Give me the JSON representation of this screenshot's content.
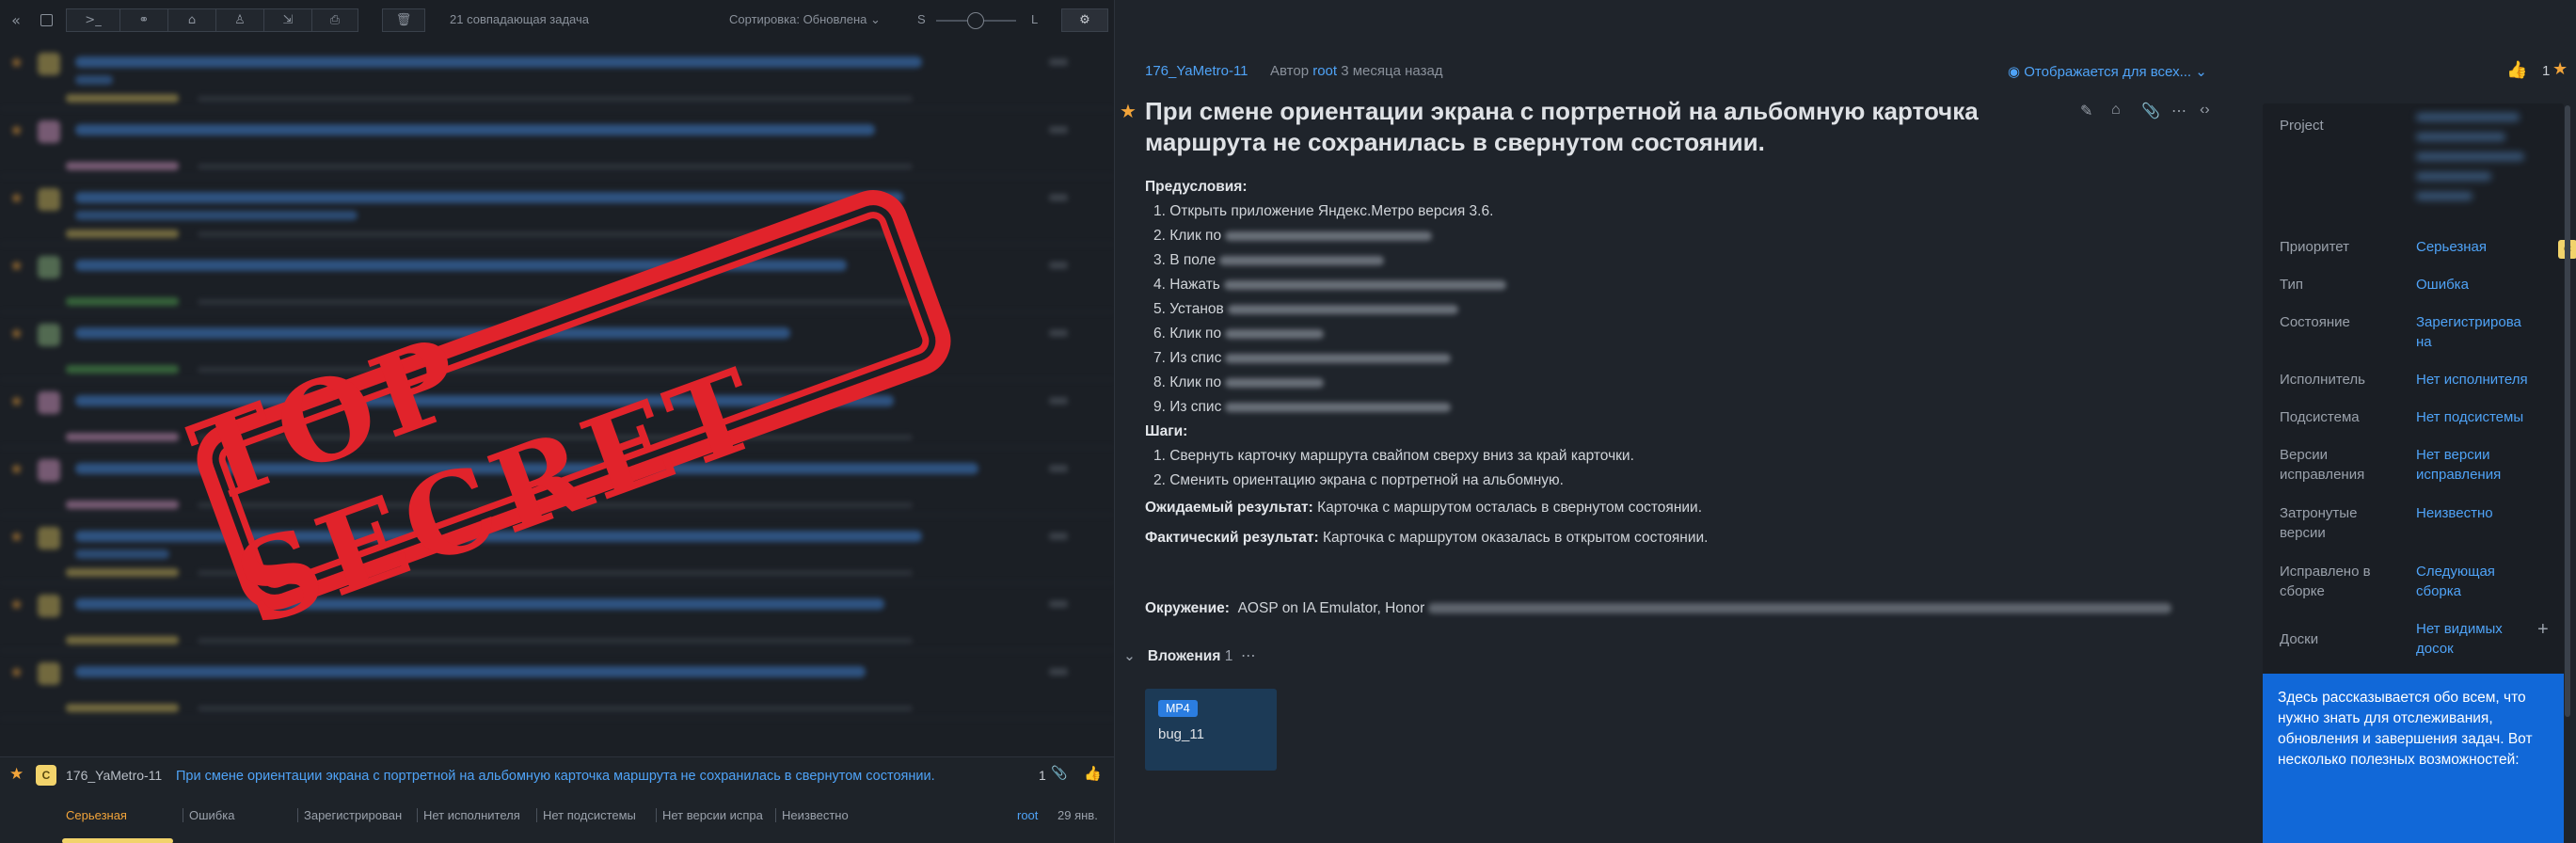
{
  "toolbar": {
    "collapse_icon": "double-chevron-left-icon",
    "match_count": "21 совпадающая задача",
    "sort_label": "Сортировка: Обновлена",
    "size_small": "S",
    "size_large": "L"
  },
  "selected_issue": {
    "avatar_letter": "C",
    "key": "176_YaMetro-11",
    "title": "При смене ориентации экрана с портретной на альбомную карточка маршрута не сохранилась в свернутом состоянии.",
    "attachment_count": "1",
    "priority": "Серьезная",
    "type": "Ошибка",
    "state": "Зарегистрирован",
    "assignee": "Нет исполнителя",
    "subsystem": "Нет подсистемы",
    "fix_versions": "Нет версии испра",
    "affected": "Неизвестно",
    "author": "root",
    "date": "29 янв."
  },
  "stamp": {
    "text": "TOP SECRET",
    "color": "#e1232b"
  },
  "issue": {
    "key": "176_YaMetro-11",
    "author_prefix": "Автор",
    "author": "root",
    "age": "3 месяца назад",
    "visibility": "Отображается для всех...",
    "like_count": "1",
    "title": "При смене ориентации экрана с портретной на альбомную карточка маршрута не сохранилась в свернутом состоянии.",
    "preconditions_heading": "Предусловия:",
    "preconditions": [
      "1. Открыть приложение Яндекс.Метро версия 3.6.",
      "2. Клик по",
      "3. В поле",
      "4. Нажать",
      "5. Установ",
      "6. Клик по",
      "7. Из спис",
      "8. Клик по",
      "9. Из спис"
    ],
    "steps_heading": "Шаги:",
    "steps": [
      "1. Свернуть карточку маршрута свайпом сверху вниз за край карточки.",
      "2. Сменить ориентацию экрана с портретной на альбомную."
    ],
    "expected_label": "Ожидаемый результат:",
    "expected": "Карточка с маршрутом осталась в свернутом состоянии.",
    "actual_label": "Фактический результат:",
    "actual": "Карточка с маршрутом оказалась в открытом состоянии.",
    "env_label": "Окружение:",
    "env": "AOSP on IA Emulator, Honor",
    "attachments_label": "Вложения",
    "attachments_count": "1",
    "attachment_type": "MP4",
    "attachment_name": "bug_11"
  },
  "side_panel": {
    "project_label": "Project",
    "fields": [
      {
        "label": "Приоритет",
        "value": "Серьезная"
      },
      {
        "label": "Тип",
        "value": "Ошибка"
      },
      {
        "label": "Состояние",
        "value": "Зарегистрирова на"
      },
      {
        "label": "Исполнитель",
        "value": "Нет исполнителя"
      },
      {
        "label": "Подсистема",
        "value": "Нет подсистемы"
      },
      {
        "label": "Версии исправления",
        "value": "Нет версии исправления"
      },
      {
        "label": "Затронутые версии",
        "value": "Неизвестно"
      },
      {
        "label": "Исправлено в сборке",
        "value": "Следующая сборка"
      },
      {
        "label": "Доски",
        "value": "Нет видимых досок"
      }
    ],
    "priority_badge": "C",
    "help_text": "Здесь рассказывается обо всем, что нужно знать для отслеживания, обновления и завершения задач. Вот несколько полезных возможностей:"
  },
  "colors": {
    "accent": "#4fa3f7",
    "star": "#f2a43a",
    "priority": "#f2a43a",
    "help_bg": "#1168d8"
  }
}
